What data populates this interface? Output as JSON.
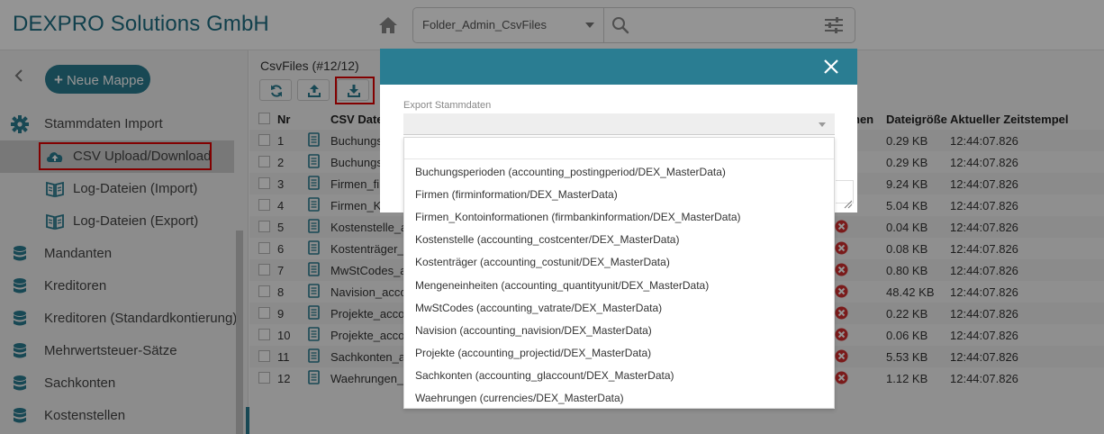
{
  "header": {
    "app_title": "DEXPRO Solutions GmbH",
    "folder_select_value": "Folder_Admin_CsvFiles"
  },
  "sidebar": {
    "new_folder_label": "Neue Mappe",
    "section_title": "Stammdaten Import",
    "sub_items": [
      {
        "label": "CSV Upload/Download",
        "icon": "cloud-icon",
        "active": true
      },
      {
        "label": "Log-Dateien (Import)",
        "icon": "book-icon"
      },
      {
        "label": "Log-Dateien (Export)",
        "icon": "book-icon"
      }
    ],
    "items": [
      {
        "label": "Mandanten",
        "icon": "database-icon"
      },
      {
        "label": "Kreditoren",
        "icon": "database-icon"
      },
      {
        "label": "Kreditoren (Standardkontierung)",
        "icon": "database-icon"
      },
      {
        "label": "Mehrwertsteuer-Sätze",
        "icon": "database-icon"
      },
      {
        "label": "Sachkonten",
        "icon": "database-icon"
      },
      {
        "label": "Kostenstellen",
        "icon": "database-icon"
      }
    ]
  },
  "main": {
    "title": "CsvFiles (#12/12)",
    "columns": {
      "nr": "Nr",
      "file": "CSV Datei",
      "status_partial": "hen",
      "size": "Dateigröße",
      "time": "Aktueller Zeitstempel"
    },
    "rows": [
      {
        "nr": "1",
        "file": "Buchungs",
        "status": "",
        "size": "0.29 KB",
        "time": "12:44:07.826"
      },
      {
        "nr": "2",
        "file": "Buchungs",
        "status": "",
        "size": "0.29 KB",
        "time": "12:44:07.826"
      },
      {
        "nr": "3",
        "file": "Firmen_fi",
        "status": "",
        "size": "9.24 KB",
        "time": "12:44:07.826"
      },
      {
        "nr": "4",
        "file": "Firmen_K",
        "status": "",
        "size": "5.04 KB",
        "time": "12:44:07.826"
      },
      {
        "nr": "5",
        "file": "Kostenstelle_a",
        "status": "error",
        "size": "0.04 KB",
        "time": "12:44:07.826"
      },
      {
        "nr": "6",
        "file": "Kostenträger_a",
        "status": "error",
        "size": "0.08 KB",
        "time": "12:44:07.826"
      },
      {
        "nr": "7",
        "file": "MwStCodes_a",
        "status": "error",
        "size": "0.80 KB",
        "time": "12:44:07.826"
      },
      {
        "nr": "8",
        "file": "Navision_acco",
        "status": "error",
        "size": "48.42 KB",
        "time": "12:44:07.826"
      },
      {
        "nr": "9",
        "file": "Projekte_acco",
        "status": "error",
        "size": "0.22 KB",
        "time": "12:44:07.826"
      },
      {
        "nr": "10",
        "file": "Projekte_acco",
        "status": "error",
        "size": "0.06 KB",
        "time": "12:44:07.826"
      },
      {
        "nr": "11",
        "file": "Sachkonten_a",
        "status": "error",
        "size": "5.53 KB",
        "time": "12:44:07.826"
      },
      {
        "nr": "12",
        "file": "Waehrungen_",
        "status": "error",
        "size": "1.12 KB",
        "time": "12:44:07.826"
      }
    ]
  },
  "modal": {
    "field_label": "Export Stammdaten",
    "selected_value": "",
    "options": [
      "Buchungsperioden (accounting_postingperiod/DEX_MasterData)",
      "Firmen (firminformation/DEX_MasterData)",
      "Firmen_Kontoinformationen (firmbankinformation/DEX_MasterData)",
      "Kostenstelle (accounting_costcenter/DEX_MasterData)",
      "Kostenträger (accounting_costunit/DEX_MasterData)",
      "Mengeneinheiten (accounting_quantityunit/DEX_MasterData)",
      "MwStCodes (accounting_vatrate/DEX_MasterData)",
      "Navision (accounting_navision/DEX_MasterData)",
      "Projekte (accounting_projectid/DEX_MasterData)",
      "Sachkonten (accounting_glaccount/DEX_MasterData)",
      "Waehrungen (currencies/DEX_MasterData)"
    ]
  },
  "colors": {
    "brand": "#2a7d92",
    "title": "#1e6e84",
    "highlight": "#e00000",
    "error": "#d32f2f"
  }
}
